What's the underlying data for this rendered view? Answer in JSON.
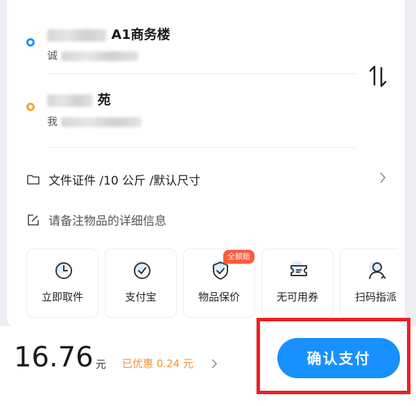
{
  "pickup": {
    "title": "A1商务楼",
    "contact_prefix": "诚",
    "dot_color": "#1890ff"
  },
  "dropoff": {
    "title": "苑",
    "contact_prefix": "我",
    "dot_color": "#f5a623"
  },
  "item_info": "文件证件 /10 公斤 /默认尺寸",
  "remark_placeholder": "请备注物品的详细信息",
  "services": [
    {
      "label": "立即取件",
      "icon": "clock-icon"
    },
    {
      "label": "支付宝",
      "icon": "check-circle-icon"
    },
    {
      "label": "物品保价",
      "icon": "shield-check-icon",
      "badge": "全额赔"
    },
    {
      "label": "无可用券",
      "icon": "coupon-icon"
    },
    {
      "label": "扫码指派",
      "icon": "person-scan-icon"
    }
  ],
  "footer": {
    "price": "16.76",
    "unit": "元",
    "discount": "已优惠 0.24 元",
    "confirm_label": "确认支付"
  },
  "colors": {
    "accent": "#1890ff",
    "discount": "#f0913a",
    "badge": "#ff5a3d",
    "highlight": "#ee1f1f"
  }
}
